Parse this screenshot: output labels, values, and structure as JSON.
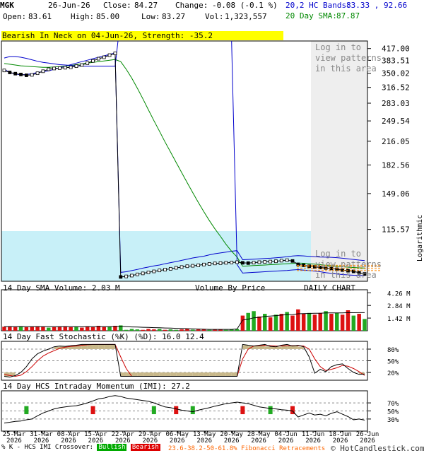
{
  "header": {
    "ticker": "MGK",
    "date": "26-Jun-26",
    "close_label": "Close:",
    "close": "84.27",
    "change_label": "Change:",
    "change": "-0.08 (-0.1 %)",
    "open_label": "Open:",
    "open": "83.61",
    "high_label": "High:",
    "high": "85.00",
    "low_label": "Low:",
    "low": "83.27",
    "vol_label": "Vol:",
    "vol": "1,323,557",
    "bands_label": "20,2 HC Bands:",
    "bands_value": "83.33 , 92.66",
    "sma_label": "20 Day SMA:",
    "sma_value": "87.87"
  },
  "pattern_banner": "Bearish In Neck on 04-Jun-26, Strength: -35.2",
  "login_text": "Log in to\nview patterns\nin this area",
  "login_text2": "Log in to\nview patterns\nin this area",
  "colors": {
    "upper_band": "#0000cc",
    "lower_band": "#0000cc",
    "sma": "#008800",
    "volume_up": "#22aa22",
    "volume_down": "#dd1111",
    "volume_by_price": "#c8f0f8",
    "login_panel": "#eeeeee",
    "stoch_fill": "#c8b88a",
    "stoch_k": "#000000",
    "stoch_d": "#cc0000",
    "fib": "#ff8800",
    "imi_bull": "#22aa22",
    "imi_bear": "#dd1111"
  },
  "volume_panel": {
    "title": "14 Day SMA Volume: 2.03 M",
    "vbp_label": "Volume By Price",
    "daily_label": "DAILY CHART"
  },
  "stoch_panel": {
    "title": "14 Day Fast Stochastic (%K) (%D): 16.0  12.4"
  },
  "imi_panel": {
    "title": "14 Day HCS Intraday Momentum (IMI): 27.2"
  },
  "footer": {
    "legend_prefix": "% K - HCS IMI Crossover:",
    "bullish": "Bullish",
    "bearish": "Bearish",
    "fib": "23.6-38.2-50-61.8% Fibonacci Retracements",
    "copyright": "© HotCandlestick.com"
  },
  "chart_data": [
    {
      "type": "line",
      "title": "",
      "scale": "logarithmic",
      "axis_label": "Logarithmic",
      "yticks": [
        "417.00",
        "383.51",
        "350.02",
        "316.52",
        "283.03",
        "249.54",
        "216.05",
        "182.56",
        "149.06",
        "115.57"
      ],
      "yticks_values": [
        417.0,
        383.51,
        350.02,
        316.52,
        283.03,
        249.54,
        216.05,
        182.56,
        149.06,
        115.57
      ],
      "xticks": [
        [
          "25-Mar",
          "2026"
        ],
        [
          "31-Mar",
          "2026"
        ],
        [
          "08-Apr",
          "2026"
        ],
        [
          "15-Apr",
          "2026"
        ],
        [
          "22-Apr",
          "2026"
        ],
        [
          "29-Apr",
          "2026"
        ],
        [
          "06-May",
          "2026"
        ],
        [
          "13-May",
          "2026"
        ],
        [
          "20-May",
          "2026"
        ],
        [
          "28-May",
          "2026"
        ],
        [
          "04-Jun",
          "2026"
        ],
        [
          "11-Jun",
          "2026"
        ],
        [
          "18-Jun",
          "2026"
        ],
        [
          "26-Jun",
          "2026"
        ]
      ],
      "series": [
        {
          "values": [
            360,
            352,
            348,
            346,
            347,
            349,
            352,
            354,
            356,
            360,
            364,
            368,
            372,
            376,
            380,
            384,
            388,
            392,
            396,
            400,
            404,
            85.2,
            85.6,
            86.3,
            87.0,
            87.8,
            88.5,
            89.2,
            89.8,
            90.6,
            91.3,
            92.0,
            92.8,
            93.6,
            94.4,
            95.0,
            95.6,
            96.5,
            97.3,
            97.8,
            98.4,
            99.0,
            99.4,
            93.2,
            93.4,
            93.6,
            93.8,
            94.0,
            94.2,
            94.5,
            94.8,
            95.2,
            95.7,
            95.9,
            95.8,
            95.5,
            95.2,
            95.0,
            94.9,
            94.8,
            94.6,
            94.2,
            93.8,
            93.4,
            93.0,
            92.66
          ]
        },
        {
          "values": [
            375,
            373,
            371,
            369,
            368,
            367,
            366,
            365,
            365,
            366,
            367,
            368,
            370,
            372,
            374,
            376,
            378,
            380,
            382,
            384,
            386,
            380,
            360,
            338,
            315,
            292,
            270,
            250,
            232,
            215,
            200,
            186,
            173,
            161,
            150,
            140,
            131,
            123,
            116,
            110,
            104,
            99,
            95,
            89.0,
            89.2,
            89.4,
            89.6,
            89.8,
            90.0,
            90.2,
            90.4,
            90.6,
            90.8,
            91.0,
            90.9,
            90.6,
            90.3,
            90.0,
            89.6,
            89.3,
            89.0,
            88.7,
            88.4,
            88.2,
            88.0,
            87.87
          ]
        },
        {
          "values": [
            390,
            394,
            394,
            392,
            389,
            385,
            381,
            378,
            376,
            374,
            372,
            371,
            370,
            369,
            368,
            368,
            368,
            368,
            368,
            368,
            368,
            520,
            540,
            560,
            575,
            590,
            600,
            610,
            614,
            616,
            614,
            610,
            604,
            598,
            590,
            582,
            572,
            560,
            545,
            526,
            500,
            440,
            90.0,
            84.8,
            85.0,
            85.2,
            85.4,
            85.6,
            85.8,
            86.0,
            86.2,
            86.4,
            86.7,
            86.9,
            86.6,
            86.3,
            86.0,
            85.6,
            85.0,
            84.6,
            84.2,
            83.9,
            83.7,
            83.5,
            83.4,
            83.33
          ]
        },
        {
          "values": [
            357,
            352,
            349,
            347,
            345,
            346,
            350,
            355,
            360,
            362,
            363,
            364,
            365,
            368,
            371,
            376,
            382,
            388,
            392,
            398,
            403,
            82.5,
            82.8,
            83.3,
            84.0,
            84.6,
            85.2,
            85.8,
            86.4,
            86.9,
            87.4,
            88.0,
            88.5,
            89.0,
            89.3,
            89.6,
            90.1,
            90.5,
            90.8,
            91.0,
            91.2,
            91.4,
            91.6,
            91.2,
            91.0,
            91.3,
            91.6,
            91.8,
            92.0,
            92.2,
            92.6,
            92.9,
            92.4,
            90.2,
            89.6,
            89.0,
            88.6,
            88.2,
            87.9,
            87.6,
            87.1,
            86.6,
            86.2,
            85.8,
            85.0,
            84.27
          ]
        }
      ]
    },
    {
      "type": "bar",
      "title": "14 Day SMA Volume: 2.03 M",
      "unit": "M",
      "yticks": [
        "4.26 M",
        "2.84 M",
        "1.42 M"
      ],
      "yticks_values": [
        4.26,
        2.84,
        1.42
      ],
      "values": [
        0.45,
        0.5,
        0.42,
        0.5,
        0.4,
        0.45,
        0.5,
        0.45,
        0.35,
        0.4,
        0.45,
        0.5,
        0.4,
        0.45,
        0.35,
        0.5,
        0.4,
        0.55,
        0.42,
        0.45,
        0.55,
        0.6,
        0.1,
        0.2,
        0.15,
        0.1,
        0.2,
        0.15,
        0.2,
        0.1,
        0.15,
        0.1,
        0.15,
        0.2,
        0.12,
        0.15,
        0.2,
        0.1,
        0.15,
        0.12,
        0.1,
        0.15,
        0.2,
        1.7,
        2.0,
        2.2,
        1.6,
        1.9,
        1.5,
        1.8,
        1.9,
        2.1,
        1.7,
        2.4,
        1.9,
        2.0,
        1.8,
        2.0,
        2.2,
        1.9,
        2.0,
        1.8,
        2.3,
        1.7,
        1.9,
        1.32
      ],
      "up": [
        false,
        false,
        false,
        true,
        false,
        false,
        false,
        false,
        true,
        false,
        false,
        false,
        false,
        true,
        false,
        false,
        false,
        false,
        false,
        true,
        false,
        true,
        true,
        true,
        true,
        false,
        false,
        false,
        true,
        false,
        true,
        true,
        false,
        false,
        true,
        false,
        false,
        true,
        false,
        false,
        true,
        true,
        true,
        false,
        true,
        true,
        false,
        true,
        false,
        true,
        false,
        true,
        false,
        false,
        false,
        true,
        false,
        false,
        true,
        false,
        true,
        false,
        false,
        true,
        false,
        true
      ],
      "sma": [
        0.45,
        0.46,
        0.46,
        0.47,
        0.46,
        0.46,
        0.46,
        0.46,
        0.45,
        0.45,
        0.45,
        0.46,
        0.45,
        0.45,
        0.44,
        0.45,
        0.45,
        0.46,
        0.46,
        0.46,
        0.47,
        0.48,
        0.45,
        0.43,
        0.41,
        0.39,
        0.37,
        0.35,
        0.33,
        0.31,
        0.29,
        0.27,
        0.25,
        0.23,
        0.21,
        0.19,
        0.17,
        0.15,
        0.15,
        0.15,
        0.15,
        0.15,
        0.2,
        1.2,
        1.3,
        1.45,
        1.5,
        1.6,
        1.65,
        1.7,
        1.75,
        1.8,
        1.82,
        1.9,
        1.92,
        1.94,
        1.96,
        1.97,
        2.0,
        2.0,
        2.0,
        2.01,
        2.03,
        2.02,
        2.03,
        2.03
      ]
    },
    {
      "type": "line",
      "title": "14 Day Fast Stochastic (%K) (%D): 16.0  12.4",
      "yticks": [
        "80%",
        "50%",
        "20%"
      ],
      "yticks_values": [
        80,
        50,
        20
      ],
      "series": [
        {
          "values": [
            10,
            8,
            12,
            20,
            35,
            55,
            68,
            75,
            80,
            86,
            88,
            87,
            89,
            90,
            92,
            92,
            92,
            92,
            92,
            92,
            92,
            10,
            10,
            10,
            10,
            10,
            10,
            10,
            10,
            10,
            10,
            10,
            10,
            10,
            10,
            10,
            10,
            10,
            10,
            10,
            10,
            10,
            10,
            92,
            90,
            88,
            90,
            92,
            87,
            86,
            90,
            92,
            88,
            90,
            86,
            60,
            18,
            28,
            22,
            35,
            40,
            42,
            30,
            20,
            15,
            16
          ]
        },
        {
          "values": [
            15,
            12,
            10,
            13,
            22,
            35,
            50,
            62,
            70,
            76,
            82,
            85,
            87,
            88,
            90,
            91,
            92,
            92,
            92,
            92,
            92,
            60,
            30,
            10,
            10,
            10,
            10,
            10,
            10,
            10,
            10,
            10,
            10,
            10,
            10,
            10,
            10,
            10,
            10,
            10,
            10,
            10,
            10,
            55,
            80,
            88,
            89,
            90,
            89,
            88,
            88,
            89,
            89,
            89,
            88,
            80,
            55,
            35,
            25,
            28,
            32,
            38,
            36,
            30,
            22,
            12.4
          ]
        }
      ]
    },
    {
      "type": "line",
      "title": "14 Day HCS Intraday Momentum (IMI): 27.2",
      "yticks": [
        "70%",
        "50%",
        "30%"
      ],
      "yticks_values": [
        70,
        50,
        30
      ],
      "values": [
        20,
        22,
        24,
        25,
        28,
        30,
        38,
        45,
        50,
        55,
        58,
        60,
        62,
        63,
        66,
        70,
        75,
        80,
        82,
        86,
        88,
        86,
        82,
        80,
        78,
        76,
        74,
        70,
        65,
        60,
        58,
        55,
        52,
        50,
        48,
        52,
        55,
        58,
        62,
        65,
        68,
        70,
        72,
        70,
        68,
        64,
        60,
        58,
        56,
        55,
        53,
        52,
        50,
        35,
        40,
        45,
        40,
        42,
        38,
        44,
        48,
        42,
        36,
        28,
        30,
        27.2
      ],
      "signals": [
        {
          "index": 4,
          "kind": "bullish"
        },
        {
          "index": 16,
          "kind": "bearish"
        },
        {
          "index": 27,
          "kind": "bullish"
        },
        {
          "index": 31,
          "kind": "bearish"
        },
        {
          "index": 34,
          "kind": "bullish"
        },
        {
          "index": 43,
          "kind": "bearish"
        },
        {
          "index": 48,
          "kind": "bullish"
        },
        {
          "index": 52,
          "kind": "bearish"
        }
      ]
    }
  ]
}
